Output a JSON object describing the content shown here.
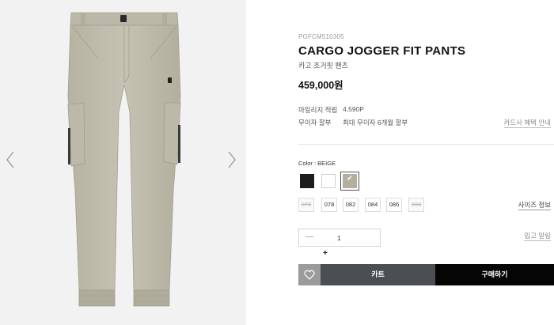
{
  "gallery": {
    "prev_icon": "chevron-left-icon",
    "next_icon": "chevron-right-icon"
  },
  "product": {
    "code": "PGFCM510305",
    "name": "CARGO JOGGER FIT PANTS",
    "subname": "카고 조거핏 팬츠",
    "price": "459,000원"
  },
  "meta": {
    "mileage_label": "마일리지 적립",
    "mileage_value": "4,590P",
    "installment_label": "무이자 할부",
    "installment_value": "최대 무이자 6개월 할부",
    "card_link": "카드사 혜택 안내"
  },
  "color": {
    "label": "Color : BEIGE",
    "selected_mark": "✔",
    "swatches": [
      {
        "name": "black",
        "hex": "#1c1c1c"
      },
      {
        "name": "white",
        "hex": "#ffffff"
      },
      {
        "name": "beige",
        "hex": "#b4b09f",
        "selected": true
      }
    ]
  },
  "sizes": [
    {
      "label": "076",
      "soldout": true
    },
    {
      "label": "078",
      "soldout": false
    },
    {
      "label": "082",
      "soldout": false
    },
    {
      "label": "084",
      "soldout": false
    },
    {
      "label": "086",
      "soldout": false
    },
    {
      "label": "090",
      "soldout": true
    }
  ],
  "size_guide": "사이즈 정보",
  "quantity": {
    "minus": "—",
    "value": "1",
    "plus": "+"
  },
  "restock_link": "입고 알림",
  "actions": {
    "wish_icon": "heart-icon",
    "cart_label": "카트",
    "buy_label": "구매하기"
  },
  "colors": {
    "cart_bg": "#4a4f54",
    "buy_bg": "#050505",
    "wish_bg": "#9b9b9b"
  }
}
